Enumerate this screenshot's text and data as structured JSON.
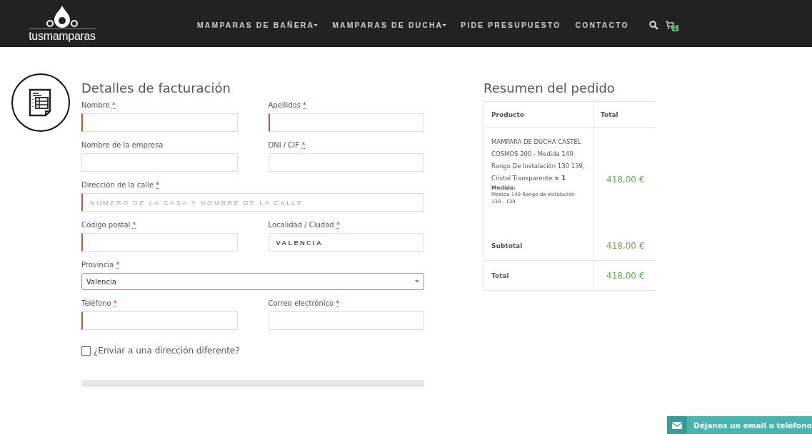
{
  "header": {
    "logo_text": "tusmamparas",
    "nav": [
      {
        "label": "MAMPARAS DE BAÑERA",
        "dropdown": true
      },
      {
        "label": "MAMPARAS DE DUCHA",
        "dropdown": true
      },
      {
        "label": "PIDE PRESUPUESTO",
        "dropdown": false
      },
      {
        "label": "CONTACTO",
        "dropdown": false
      }
    ],
    "cart_count": "1"
  },
  "billing": {
    "title": "Detalles de facturación",
    "rows": [
      [
        {
          "kind": "text",
          "label": "Nombre",
          "required_mark": "*",
          "invalid": true
        },
        {
          "kind": "text",
          "label": "Apellidos",
          "required_mark": "*",
          "invalid": true
        }
      ],
      [
        {
          "kind": "text",
          "label": "Nombre de la empresa",
          "invalid": false
        },
        {
          "kind": "text",
          "label": "DNI / CIF",
          "required_mark": "*",
          "invalid": false
        }
      ],
      [
        {
          "kind": "text",
          "label": "Dirección de la calle",
          "required_mark": "*",
          "invalid": true,
          "placeholder": "NÚMERO DE LA CASA Y NOMBRE DE LA CALLE"
        }
      ],
      [
        {
          "kind": "text",
          "label": "Código postal",
          "required_mark": "*",
          "invalid": true
        },
        {
          "kind": "text",
          "label": "Localidad / Ciudad",
          "required_mark": "*",
          "invalid": false,
          "value": "VALENCIA"
        }
      ],
      [
        {
          "kind": "select",
          "label": "Provincia",
          "required_mark": "*",
          "value": "Valencia"
        }
      ],
      [
        {
          "kind": "text",
          "label": "Teléfono",
          "required_mark": "*",
          "invalid": true
        },
        {
          "kind": "text",
          "label": "Correo electrónico",
          "required_mark": "*",
          "invalid": false
        }
      ]
    ],
    "ship_different": {
      "label": "¿Enviar a una dirección diferente?",
      "checked": false
    }
  },
  "order_summary": {
    "title": "Resumen del pedido",
    "columns": [
      "Producto",
      "Total"
    ],
    "item": {
      "name": "MAMPARA DE DUCHA CASTEL COSMOS 200 - Medida 140 Rango De Instalación 130 139, Cristal Transparente",
      "quantity": "× 1",
      "meta_label": "Medida:",
      "meta_value": "Medida 140 Rango de instalación 130 - 139",
      "total": "418,00 €"
    },
    "totals": [
      {
        "label": "Subtotal",
        "value": "418,00 €"
      },
      {
        "label": "Total",
        "value": "418,00 €"
      }
    ]
  },
  "contact_tab": {
    "label": "Déjanos un email o teléfono"
  }
}
